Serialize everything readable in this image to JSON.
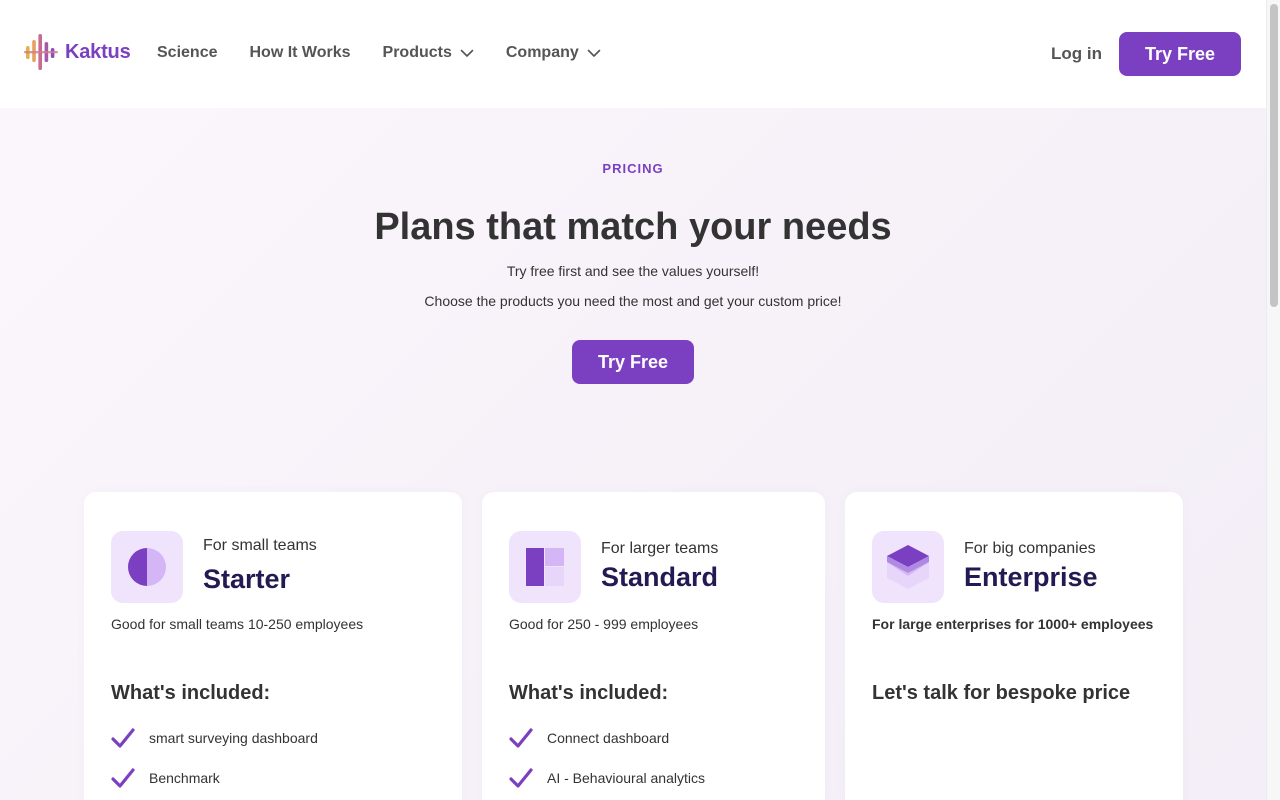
{
  "brand": {
    "name": "Kaktus",
    "accent": "#7b40c2",
    "dark_text": "#221a52"
  },
  "nav": {
    "items": [
      {
        "label": "Science",
        "has_dropdown": false
      },
      {
        "label": "How It Works",
        "has_dropdown": false
      },
      {
        "label": "Products",
        "has_dropdown": true
      },
      {
        "label": "Company",
        "has_dropdown": true
      }
    ],
    "login_label": "Log in",
    "cta_label": "Try Free"
  },
  "hero": {
    "eyebrow": "PRICING",
    "title": "Plans that match your needs",
    "subtitle_1": "Try free first and see the values yourself!",
    "subtitle_2": "Choose the products you need the most and get your custom price!",
    "cta_label": "Try Free"
  },
  "plans": [
    {
      "audience": "For small teams",
      "name": "Starter",
      "description": "Good for small teams 10-250 employees",
      "section_title": "What's included:",
      "features": [
        "smart surveying dashboard",
        "Benchmark"
      ],
      "icon": "half-circle-icon"
    },
    {
      "audience": "For larger teams",
      "name": "Standard",
      "description": "Good for 250 - 999 employees",
      "section_title": "What's included:",
      "features": [
        "Connect dashboard",
        "AI - Behavioural analytics"
      ],
      "icon": "blocks-icon"
    },
    {
      "audience": "For big companies",
      "name": "Enterprise",
      "description": "For large enterprises for 1000+ employees",
      "section_title": "Let's talk for bespoke price",
      "features": [],
      "icon": "stacked-layers-icon"
    }
  ]
}
